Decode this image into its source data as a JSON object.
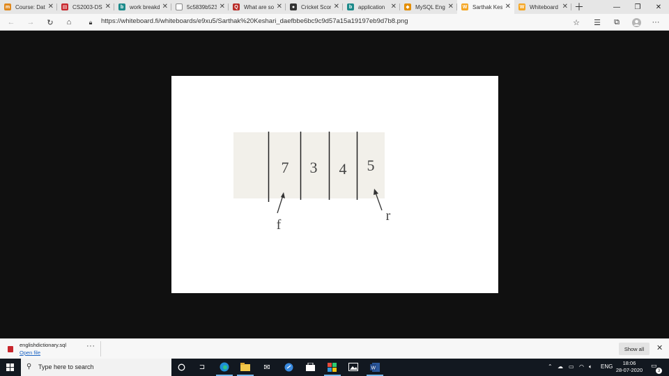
{
  "browser": {
    "tabs": [
      {
        "title": "Course: Data",
        "favicon": "moodle-icon",
        "color": "#e0881c",
        "glyph": "m"
      },
      {
        "title": "CS2003-DS",
        "favicon": "pdf-icon",
        "color": "#c8262c",
        "glyph": "▤"
      },
      {
        "title": "work breakd",
        "favicon": "bing-icon",
        "color": "#1c8a8a",
        "glyph": "b"
      },
      {
        "title": "5c5839b523",
        "favicon": "document-icon",
        "color": "#ffffff",
        "glyph": ""
      },
      {
        "title": "What are so",
        "favicon": "quora-icon",
        "color": "#b92b27",
        "glyph": "Q"
      },
      {
        "title": "Cricket Score",
        "favicon": "cricket-icon",
        "color": "#333333",
        "glyph": "●"
      },
      {
        "title": "application",
        "favicon": "bing-icon",
        "color": "#1c8a8a",
        "glyph": "b"
      },
      {
        "title": "MySQL Engli",
        "favicon": "mysql-icon",
        "color": "#e48e00",
        "glyph": "◆"
      },
      {
        "title": "Sarthak Kesl",
        "favicon": "whiteboard-icon",
        "color": "#f5a623",
        "glyph": "W",
        "active": true
      },
      {
        "title": "Whiteboard",
        "favicon": "whiteboard-icon",
        "color": "#f5a623",
        "glyph": "W"
      }
    ],
    "url": "https://whiteboard.fi/whiteboards/e9xu5/Sarthak%20Keshari_daefbbe6bc9c9d57a15a19197eb9d7b8.png"
  },
  "figure": {
    "values": [
      "7",
      "3",
      "4",
      "5"
    ],
    "front_label": "f",
    "rear_label": "r"
  },
  "download": {
    "filename": "englishdictionary.sql",
    "open_label": "Open file",
    "more": "···",
    "show_all": "Show all"
  },
  "taskbar": {
    "search_placeholder": "Type here to search",
    "language": "ENG",
    "time": "18:06",
    "date": "28-07-2020",
    "notification_count": "3"
  }
}
